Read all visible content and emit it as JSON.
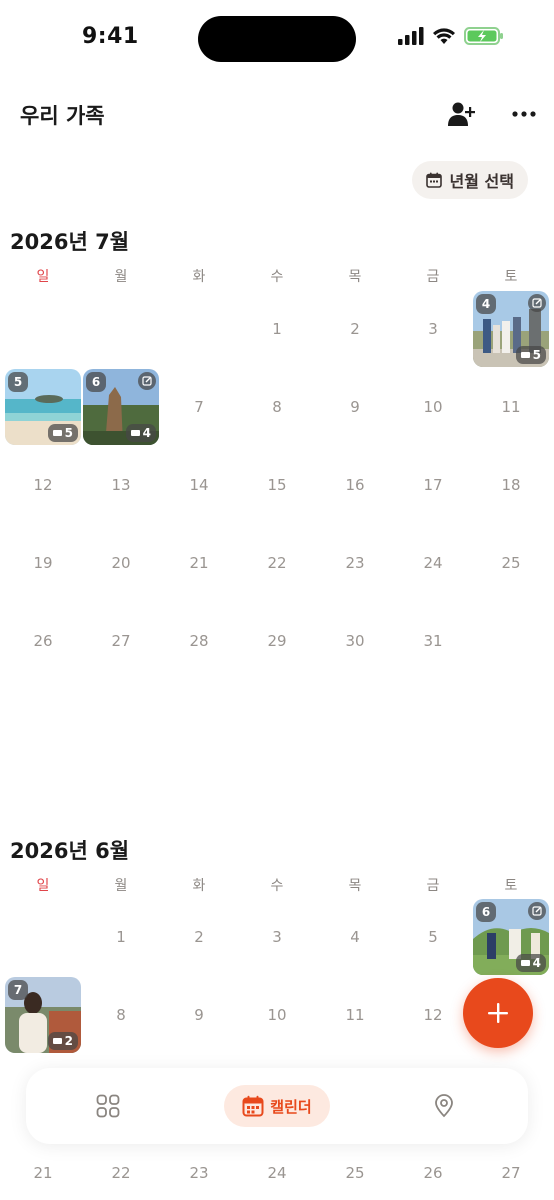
{
  "status_bar": {
    "time": "9:41"
  },
  "header": {
    "title": "우리 가족",
    "add_member_icon": "person-add-icon",
    "more_icon": "more-horizontal-icon"
  },
  "picker": {
    "label": "년월 선택",
    "icon": "calendar-icon"
  },
  "weekdays": [
    "일",
    "월",
    "화",
    "수",
    "목",
    "금",
    "토"
  ],
  "months": [
    {
      "title": "2026년 7월",
      "days": [
        "1",
        "2",
        "3",
        "7",
        "8",
        "9",
        "10",
        "11",
        "12",
        "13",
        "14",
        "15",
        "16",
        "17",
        "18",
        "19",
        "20",
        "21",
        "22",
        "23",
        "24",
        "25",
        "26",
        "27",
        "28",
        "29",
        "30",
        "31"
      ],
      "photos": [
        {
          "day": "4",
          "count": "5",
          "has_edit": true
        },
        {
          "day": "5",
          "count": "5",
          "has_edit": false
        },
        {
          "day": "6",
          "count": "4",
          "has_edit": true
        }
      ]
    },
    {
      "title": "2026년 6월",
      "days": [
        "1",
        "2",
        "3",
        "4",
        "5",
        "8",
        "9",
        "10",
        "11",
        "12",
        "21",
        "22",
        "23",
        "24",
        "25",
        "26",
        "27"
      ],
      "photos": [
        {
          "day": "6",
          "count": "4",
          "has_edit": true
        },
        {
          "day": "7",
          "count": "2",
          "has_edit": false
        }
      ]
    }
  ],
  "fab": {
    "icon": "plus-icon"
  },
  "tabbar": {
    "grid_icon": "grid-icon",
    "active_label": "캘린더",
    "active_icon": "calendar-icon",
    "map_icon": "location-pin-icon"
  },
  "colors": {
    "accent": "#e8491c",
    "sunday": "#e0454a",
    "day_text": "#9a9591"
  }
}
